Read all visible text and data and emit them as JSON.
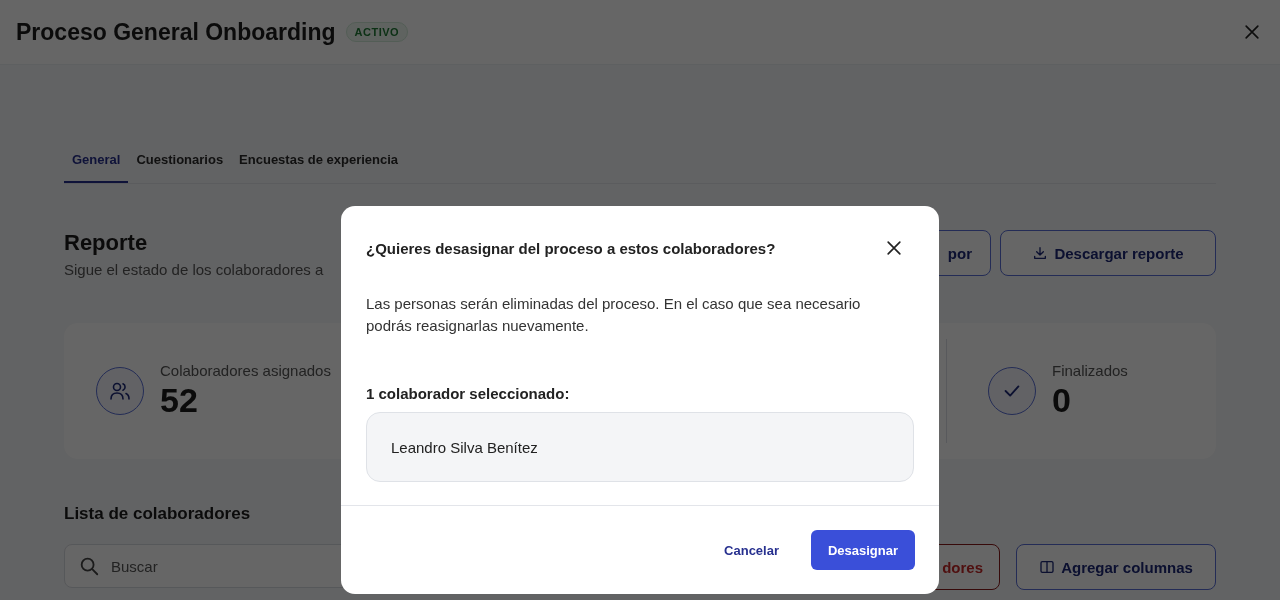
{
  "header": {
    "title": "Proceso General Onboarding",
    "status_badge": "ACTIVO"
  },
  "tabs": [
    {
      "label": "General",
      "selected": true
    },
    {
      "label": "Cuestionarios",
      "selected": false
    },
    {
      "label": "Encuestas de experiencia",
      "selected": false
    }
  ],
  "report": {
    "title": "Reporte",
    "subtitle": "Sigue el estado de los colaboradores a",
    "buttons": [
      {
        "label": "por",
        "kind": "plain"
      },
      {
        "label": "Descargar reporte",
        "kind": "download"
      }
    ]
  },
  "stats": [
    {
      "label": "Colaboradores asignados",
      "value": "52",
      "kind": "people"
    },
    {
      "label": "Finalizados",
      "value": "0",
      "kind": "done"
    }
  ],
  "list": {
    "title": "Lista de colaboradores",
    "search": {
      "placeholder": "Buscar"
    },
    "buttons": [
      {
        "label": "dores",
        "kind": "danger"
      },
      {
        "label": "Agregar columnas",
        "kind": "columns"
      }
    ]
  },
  "dialog": {
    "title": "¿Quieres desasignar del proceso a estos colaboradores?",
    "message": "Las personas serán eliminadas del proceso. En el caso que sea necesario podrás reasignarlas nuevamente.",
    "selection_label": "1 colaborador seleccionado:",
    "selected_people": [
      "Leandro Silva Benítez"
    ],
    "buttons": [
      {
        "label": "Cancelar",
        "kind": "text"
      },
      {
        "label": "Desasignar",
        "kind": "primary"
      }
    ]
  }
}
